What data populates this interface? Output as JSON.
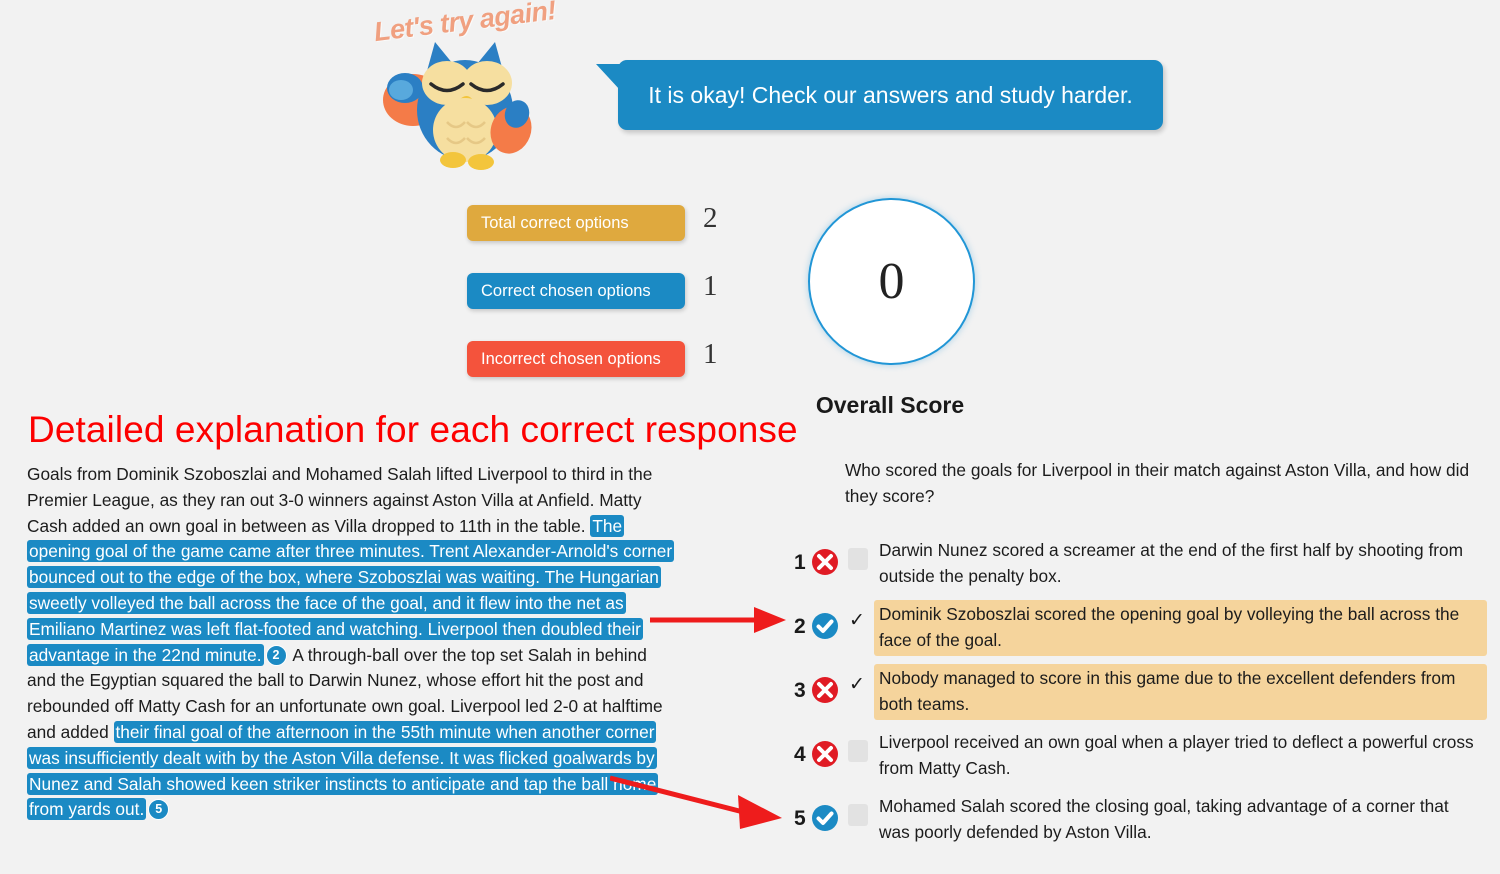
{
  "mascot": {
    "caption": "Let's try again!",
    "icon": "owl-illustration"
  },
  "speech_bubble": {
    "message": "It is okay! Check our answers and study harder."
  },
  "stats": [
    {
      "label": "Total correct options",
      "value": "2",
      "color": "#dfa93e"
    },
    {
      "label": "Correct chosen options",
      "value": "1",
      "color": "#1b8ac4"
    },
    {
      "label": "Incorrect chosen options",
      "value": "1",
      "color": "#f4533c"
    }
  ],
  "score": {
    "value": "0",
    "caption": "Overall Score",
    "ring_color": "#2196d6"
  },
  "detailed": {
    "heading": "Detailed explanation for each correct response"
  },
  "passage": {
    "segments": [
      {
        "type": "plain",
        "text": "Goals from Dominik Szoboszlai and Mohamed Salah lifted Liverpool to third in the Premier League, as they ran out 3-0 winners against Aston Villa at Anfield. Matty Cash added an own goal in between as Villa dropped to 11th in the table. "
      },
      {
        "type": "highlight",
        "text": "The opening goal of the game came after three minutes. Trent Alexander-Arnold's corner bounced out to the edge of the box, where Szoboszlai was waiting. The Hungarian sweetly volleyed the ball across the face of the goal, and it flew into the net as Emiliano Martinez was left flat-footed and watching. Liverpool then doubled their advantage in the 22nd minute."
      },
      {
        "type": "badge",
        "text": "2"
      },
      {
        "type": "plain",
        "text": " A through-ball over the top set Salah in behind and the Egyptian squared the ball to Darwin Nunez, whose effort hit the post and rebounded off Matty Cash for an unfortunate own goal. Liverpool led 2-0 at halftime and added "
      },
      {
        "type": "highlight",
        "text": "their final goal of the afternoon in the 55th minute when another corner was insufficiently dealt with by the Aston Villa defense. It was flicked goalwards by Nunez and Salah showed keen striker instincts to anticipate and tap the ball home from yards out."
      },
      {
        "type": "badge",
        "text": "5"
      }
    ]
  },
  "qa": {
    "question": "Who scored the goals for Liverpool in their match against Aston Villa, and how did they score?",
    "answers": [
      {
        "number": "1",
        "mark": "incorrect-icon",
        "checked": false,
        "highlighted": false,
        "text": "Darwin Nunez scored a screamer at the end of the first half by shooting from outside the penalty box."
      },
      {
        "number": "2",
        "mark": "correct-icon",
        "checked": true,
        "highlighted": true,
        "text": "Dominik Szoboszlai scored the opening goal by volleying the ball across the face of the goal."
      },
      {
        "number": "3",
        "mark": "incorrect-icon",
        "checked": true,
        "highlighted": true,
        "text": "Nobody managed to score in this game due to the excellent defenders from both teams."
      },
      {
        "number": "4",
        "mark": "incorrect-icon",
        "checked": false,
        "highlighted": false,
        "text": "Liverpool received an own goal when a player tried to deflect a powerful cross from Matty Cash."
      },
      {
        "number": "5",
        "mark": "correct-icon",
        "checked": false,
        "highlighted": false,
        "text": "Mohamed Salah scored the closing goal, taking advantage of a corner that was poorly defended by Aston Villa."
      }
    ]
  },
  "annotations": {
    "arrow_color": "#ee1c1c",
    "arrows": [
      "arrow-to-answer-2",
      "arrow-to-answer-5"
    ]
  },
  "colors": {
    "background": "#f2f2f2",
    "highlight_blue": "#1b8ac4",
    "highlight_amber": "#f5d49c",
    "heading_red": "#fd0000"
  }
}
